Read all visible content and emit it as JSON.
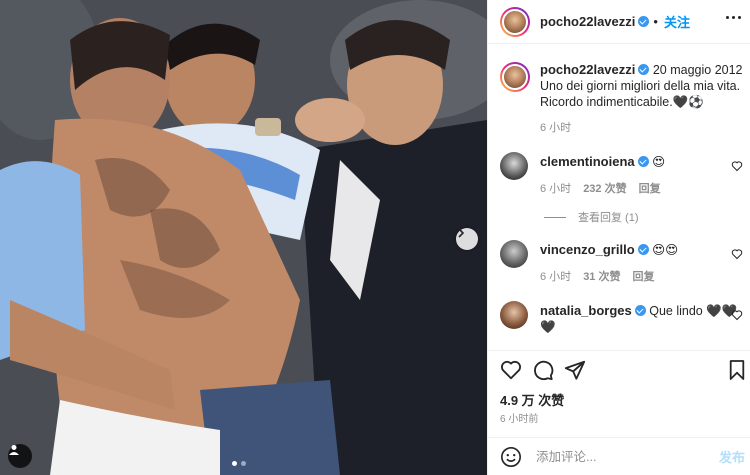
{
  "post": {
    "username": "pocho22lavezzi",
    "follow_label": "关注",
    "caption_date": "20 maggio 2012",
    "caption_line1": "Uno dei giorni migliori della mia vita.",
    "caption_line2": "Ricordo indimenticabile.🖤⚽",
    "caption_time": "6 小时"
  },
  "comments": [
    {
      "user": "clementinoiena",
      "text": "😍",
      "time": "6 小时",
      "likes": "232 次赞",
      "reply": "回复",
      "view_replies": "查看回复 (1)"
    },
    {
      "user": "vincenzo_grillo",
      "text": "😍😍",
      "time": "6 小时",
      "likes": "31 次赞",
      "reply": "回复"
    },
    {
      "user": "natalia_borges",
      "text": "Que lindo 🖤🖤🖤"
    }
  ],
  "footer": {
    "likes_count": "4.9 万 次赞",
    "posted_ago": "6 小时前",
    "comment_placeholder": "添加评论...",
    "post_label": "发布"
  },
  "colors": {
    "accent": "#0095f6",
    "verified": "#3897f0",
    "muted": "#8e8e8e"
  },
  "carousel": {
    "total": 2,
    "current": 1
  }
}
